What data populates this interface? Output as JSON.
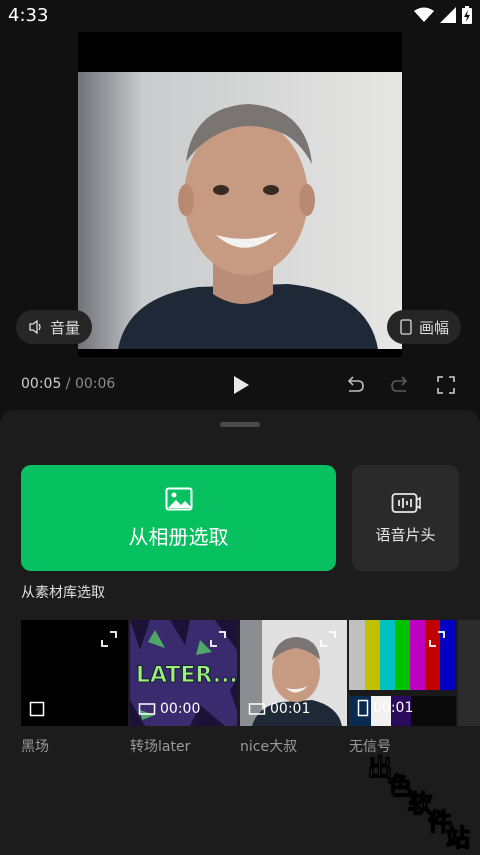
{
  "status": {
    "time": "4:33"
  },
  "player": {
    "volume_label": "音量",
    "canvas_label": "画幅",
    "current_time": "00:05",
    "separator": " / ",
    "total_time": "00:06"
  },
  "sheet": {
    "album_button": "从相册选取",
    "voice_button": "语音片头",
    "library_title": "从素材库选取",
    "items": [
      {
        "caption": "黑场",
        "duration": ""
      },
      {
        "caption": "转场later",
        "duration": "00:00",
        "text_art": "LATER..."
      },
      {
        "caption": "nice大叔",
        "duration": "00:01"
      },
      {
        "caption": "无信号",
        "duration": "00:01"
      }
    ]
  },
  "watermark": {
    "text": "出色软件站"
  },
  "colors": {
    "accent": "#07c160",
    "background": "#111111",
    "sheet": "#1c1c1c"
  }
}
